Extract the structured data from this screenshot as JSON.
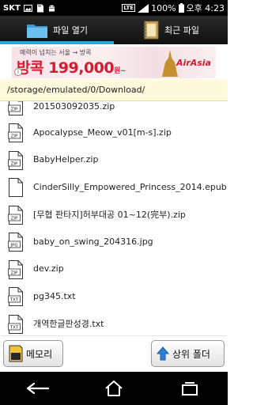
{
  "status_bar": {
    "carrier": "SKT",
    "network": "LTE",
    "battery": "100%",
    "time": "오후 4:23",
    "icons": [
      "gallery-icon",
      "sd-card-icon",
      "android-debug-icon",
      "signal-icon",
      "battery-icon"
    ]
  },
  "tabs": [
    {
      "label": "파일 열기",
      "icon": "folder-icon",
      "active": true
    },
    {
      "label": "최근 파일",
      "icon": "notebook-icon",
      "active": false
    }
  ],
  "ad": {
    "top_text": "매력이 넘치는  서울  →  방콕",
    "main_text": "방콕 199,000",
    "main_suffix": "원~",
    "brand": "AirAsia",
    "info_icon": "i"
  },
  "path": "/storage/emulated/0/Download/",
  "files": [
    {
      "name": "20150309203​5.zip",
      "type": "ZIP"
    },
    {
      "name": "Apocalypse_Meow_v01[m-s].zip",
      "type": "ZIP"
    },
    {
      "name": "BabyHelper.zip",
      "type": "ZIP"
    },
    {
      "name": "CinderSilly_Empowered_Princess_2014.epub",
      "type": ""
    },
    {
      "name": "[무협 판타지]허부대공 01~12(完부).zip",
      "type": "ZIP"
    },
    {
      "name": "baby_on_swing_204316.jpg",
      "type": "JPG"
    },
    {
      "name": "dev.zip",
      "type": "ZIP"
    },
    {
      "name": "pg345.txt",
      "type": "TXT"
    },
    {
      "name": "개역한글판성경.txt",
      "type": "TXT"
    }
  ],
  "buttons": {
    "memory": "메모리",
    "up_folder": "상위 폴더"
  },
  "colors": {
    "accent": "#27a9e1",
    "path_bg": "#fffadb",
    "ad_red": "#d41c33"
  }
}
